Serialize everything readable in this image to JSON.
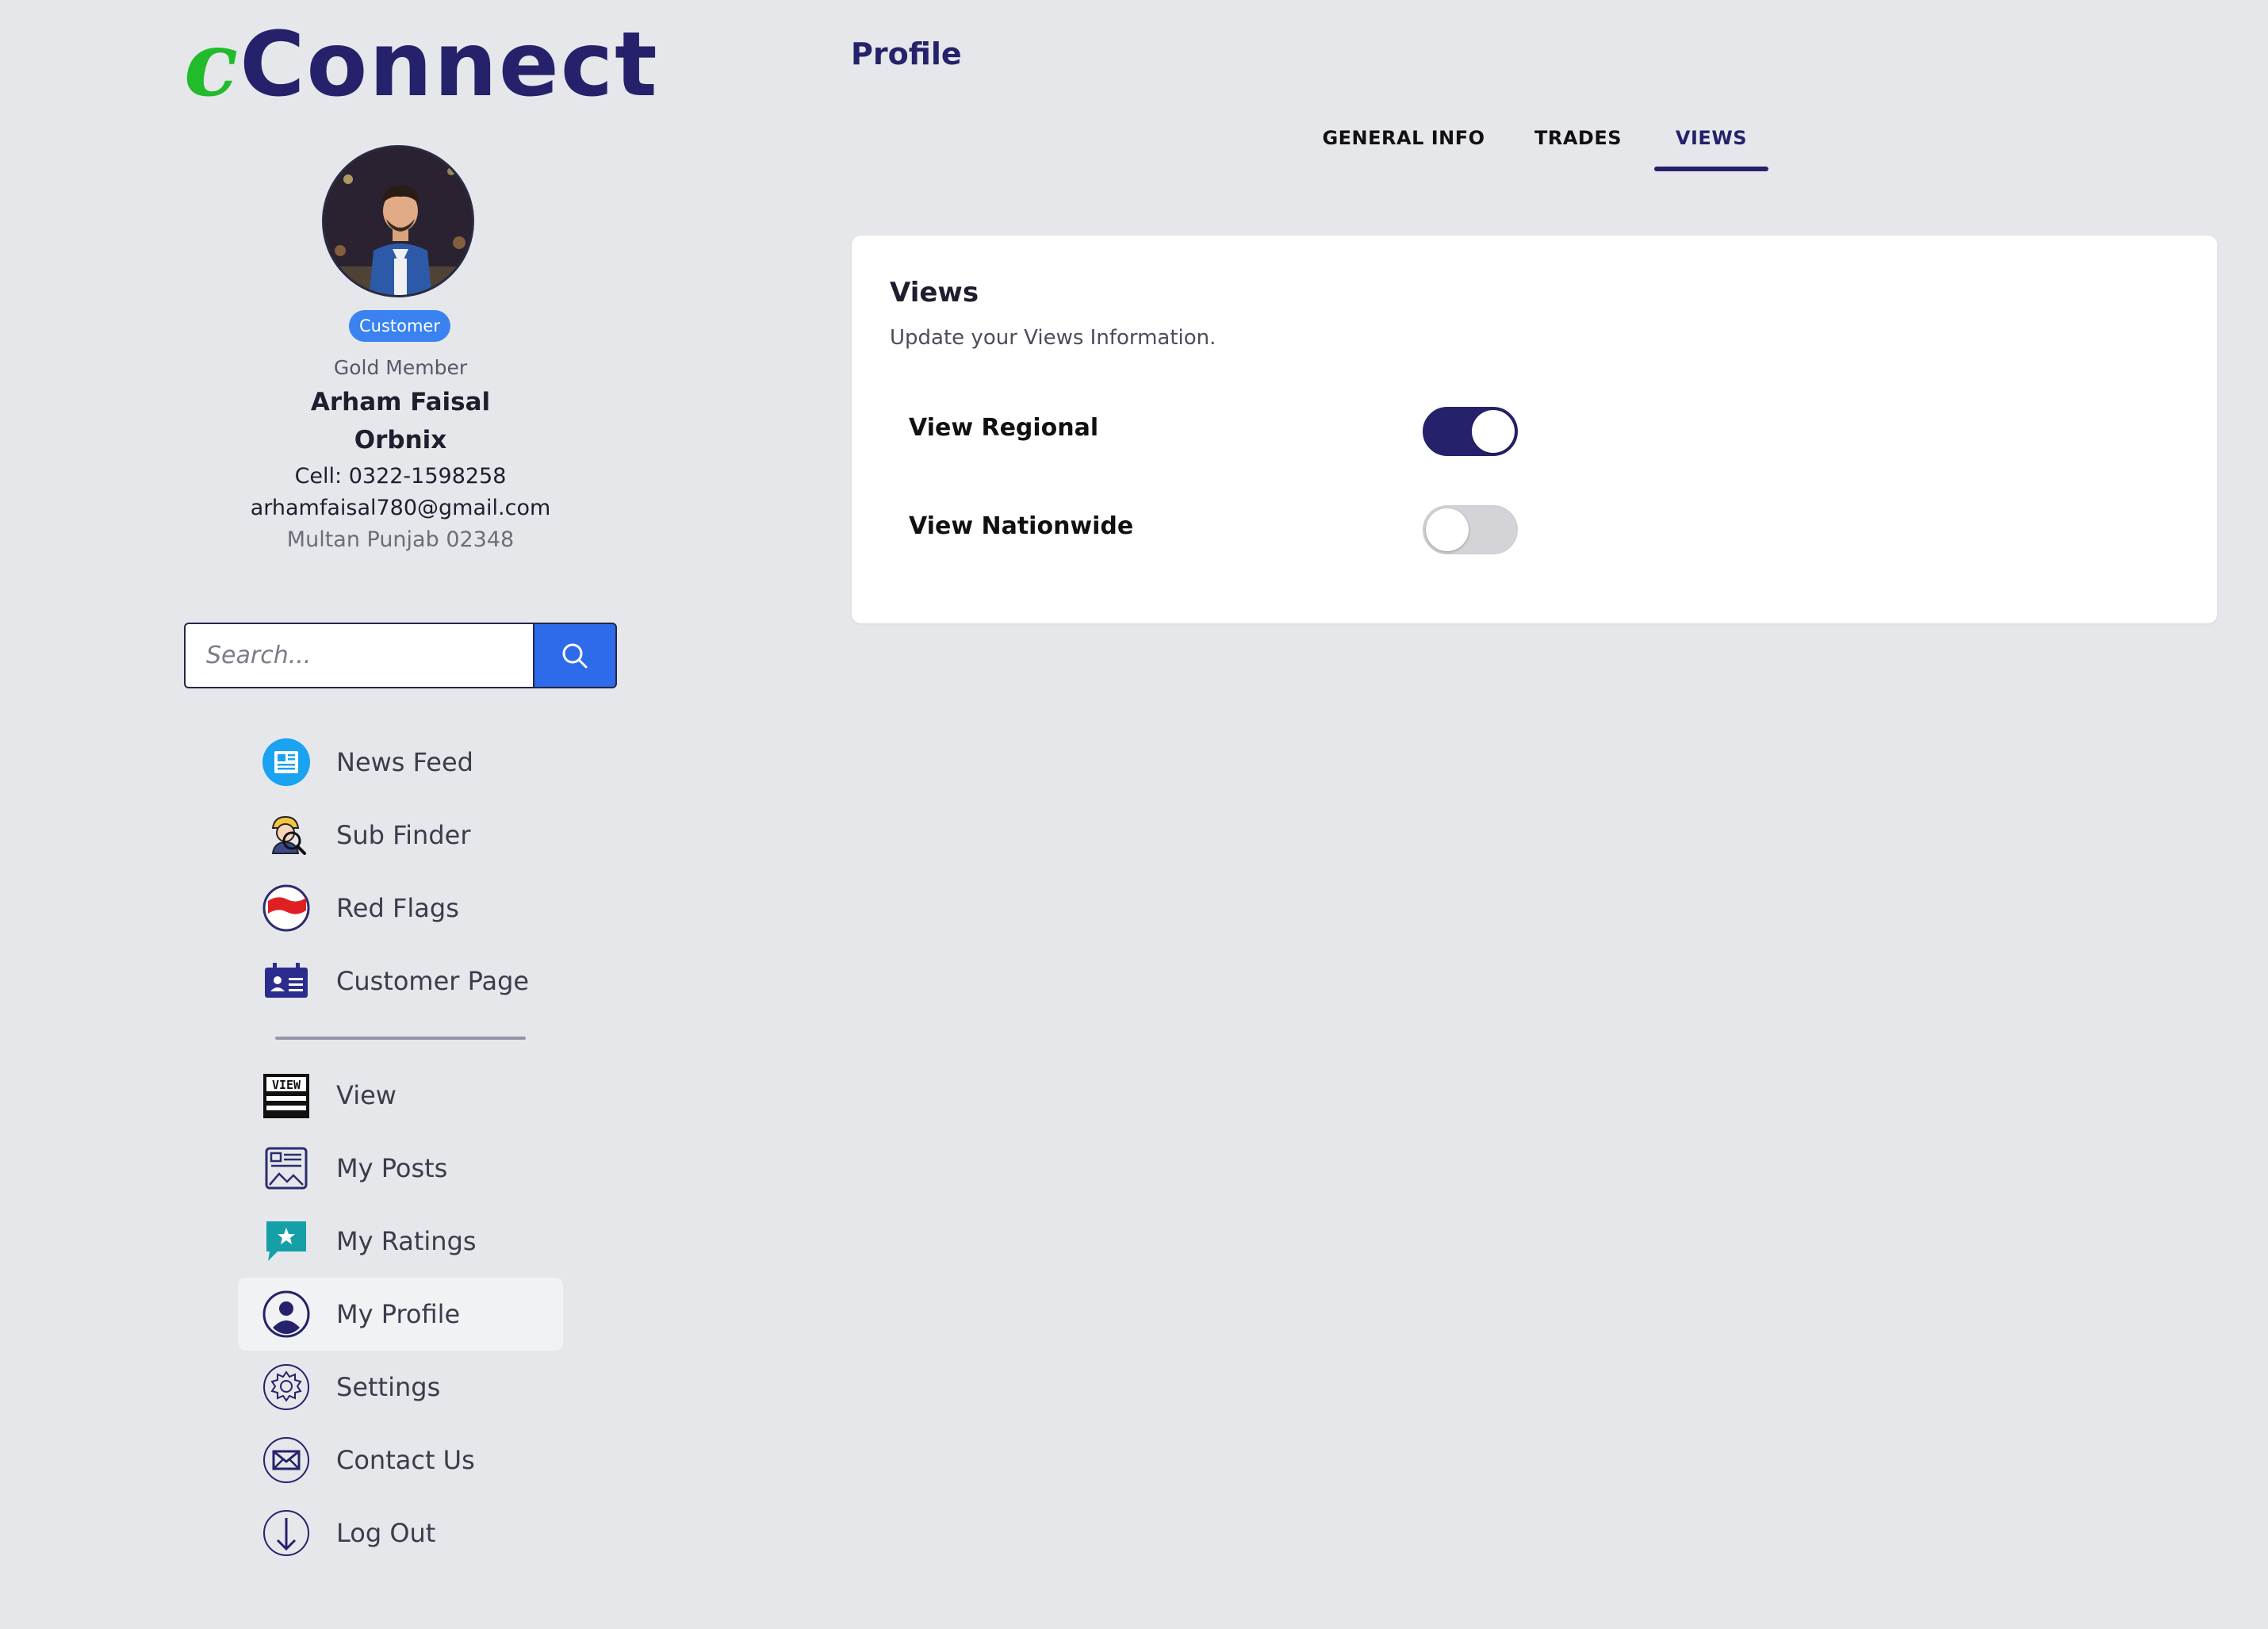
{
  "app": {
    "logo_mark": "c",
    "logo_text": "Connect"
  },
  "profile": {
    "role_badge": "Customer",
    "membership": "Gold Member",
    "name": "Arham Faisal",
    "company": "Orbnix",
    "cell": "Cell: 0322-1598258",
    "email": "arhamfaisal780@gmail.com",
    "address": "Multan Punjab 02348"
  },
  "search": {
    "placeholder": "Search..."
  },
  "nav": {
    "primary": [
      {
        "label": "News Feed",
        "icon": "newspaper-icon"
      },
      {
        "label": "Sub Finder",
        "icon": "worker-search-icon"
      },
      {
        "label": "Red Flags",
        "icon": "red-flag-icon"
      },
      {
        "label": "Customer Page",
        "icon": "id-card-icon"
      }
    ],
    "secondary": [
      {
        "label": "View",
        "icon": "view-icon"
      },
      {
        "label": "My Posts",
        "icon": "posts-icon"
      },
      {
        "label": "My Ratings",
        "icon": "star-chat-icon"
      },
      {
        "label": "My Profile",
        "icon": "user-icon",
        "active": true
      },
      {
        "label": "Settings",
        "icon": "gear-icon"
      },
      {
        "label": "Contact Us",
        "icon": "envelope-icon"
      },
      {
        "label": "Log Out",
        "icon": "arrow-down-icon"
      }
    ]
  },
  "main": {
    "page_title": "Profile",
    "tabs": [
      {
        "label": "GENERAL INFO"
      },
      {
        "label": "TRADES"
      },
      {
        "label": "VIEWS",
        "active": true
      }
    ],
    "card": {
      "title": "Views",
      "subtitle": "Update your Views Information.",
      "options": [
        {
          "label": "View Regional",
          "enabled": true
        },
        {
          "label": "View Nationwide",
          "enabled": false
        }
      ]
    }
  },
  "colors": {
    "brand": "#25226b",
    "logo_accent": "#22bb2a",
    "badge": "#3a82f0",
    "search_button": "#2d6bea",
    "background": "#e6e7eb"
  }
}
